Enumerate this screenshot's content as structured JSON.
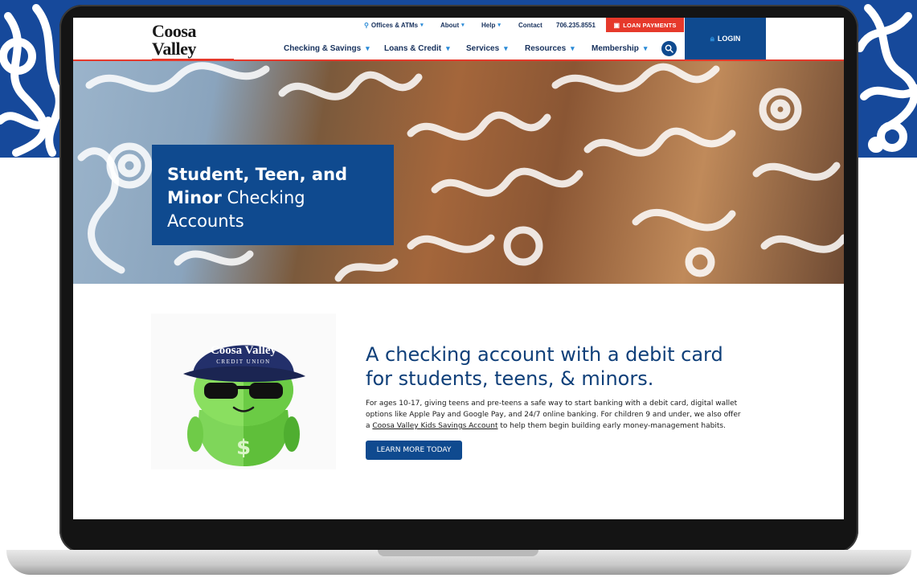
{
  "header": {
    "logo": {
      "title": "Coosa Valley",
      "subtitle": "CREDIT UNION"
    },
    "utility_nav": {
      "offices": "Offices & ATMs",
      "about": "About",
      "help": "Help",
      "contact": "Contact",
      "phone": "706.235.8551"
    },
    "loan_payments": "LOAN PAYMENTS",
    "login": "LOGIN",
    "main_nav": [
      {
        "label": "Checking & Savings"
      },
      {
        "label": "Loans & Credit"
      },
      {
        "label": "Services"
      },
      {
        "label": "Resources"
      },
      {
        "label": "Membership"
      }
    ]
  },
  "hero": {
    "title_bold": "Student, Teen, and",
    "title_bold2": "Minor",
    "title_rest": "Checking",
    "title_line3": "Accounts"
  },
  "mascot": {
    "cap_line1": "Coosa Valley",
    "cap_line2": "CREDIT UNION"
  },
  "content": {
    "headline": "A checking account with a debit card for students, teens, & minors.",
    "body_before_link": "For ages 10-17, giving teens and pre-teens a safe way to start banking with a debit card, digital wallet options like Apple Pay and Google Pay, and 24/7 online banking. For children 9 and under, we also offer a",
    "link": "Coosa Valley Kids Savings Account",
    "body_after_link": "to help them begin building early money-management habits.",
    "cta": "LEARN MORE TODAY"
  },
  "colors": {
    "brand_blue": "#0f4a8f",
    "accent_red": "#e6392b",
    "backdrop_blue": "#16499b"
  }
}
